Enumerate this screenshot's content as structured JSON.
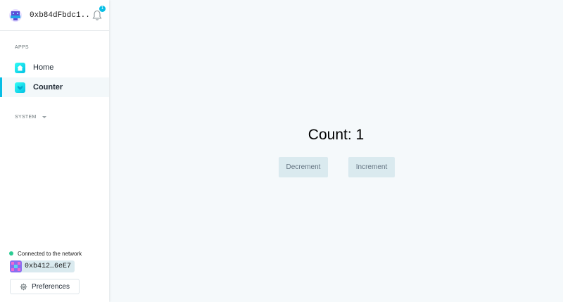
{
  "header": {
    "org_name": "0xb84dFbdc1...",
    "notification_count": "1",
    "org_avatar_icon": "org-identicon",
    "bell_icon": "bell-icon"
  },
  "sidebar": {
    "apps_label": "APPS",
    "items": [
      {
        "label": "Home",
        "icon": "home-icon",
        "active": false
      },
      {
        "label": "Counter",
        "icon": "counter-app-icon",
        "active": true
      }
    ],
    "system_label": "SYSTEM"
  },
  "footer": {
    "network_status": "Connected to the network",
    "account_address": "0xb412…6eE7",
    "preferences_label": "Preferences"
  },
  "main": {
    "count_text": "Count: 1",
    "decrement_label": "Decrement",
    "increment_label": "Increment"
  },
  "colors": {
    "accent": "#08bee5",
    "connected": "#2ccc93",
    "button_bg": "#daeaef",
    "page_bg": "#f5f9fb"
  }
}
